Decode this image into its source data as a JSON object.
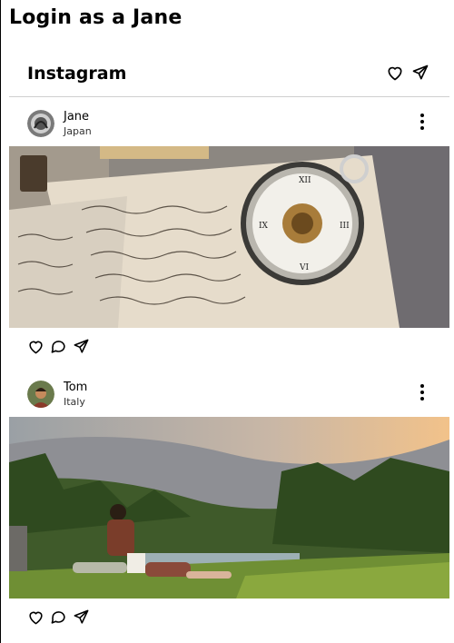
{
  "page": {
    "title": "Login as a Jane"
  },
  "header": {
    "brand": "Instagram",
    "icons": [
      "heart-icon",
      "send-icon"
    ]
  },
  "posts": [
    {
      "user": "Jane",
      "location": "Japan",
      "image": "pocket watch on handwritten letters",
      "actions": [
        "heart-icon",
        "comment-icon",
        "send-icon"
      ]
    },
    {
      "user": "Tom",
      "location": "Italy",
      "image": "couple sitting on grass by a river at sunset",
      "actions": [
        "heart-icon",
        "comment-icon",
        "send-icon"
      ]
    }
  ]
}
